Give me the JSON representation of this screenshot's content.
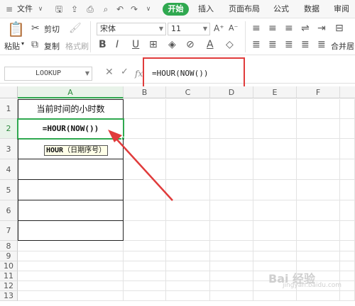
{
  "menubar": {
    "file": "文件",
    "tabs": [
      "开始",
      "插入",
      "页面布局",
      "公式",
      "数据",
      "审阅"
    ]
  },
  "ribbon": {
    "paste": "粘贴",
    "cut": "剪切",
    "copy": "复制",
    "format_painter": "格式刷",
    "font_name": "宋体",
    "font_size": "11",
    "merge_center": "合并居中"
  },
  "formula_bar": {
    "name_box": "LOOKUP",
    "fx": "fx",
    "formula": "=HOUR(NOW())"
  },
  "grid": {
    "columns": [
      "A",
      "B",
      "C",
      "D",
      "E",
      "F"
    ],
    "rows": [
      "1",
      "2",
      "3",
      "4",
      "5",
      "6",
      "7",
      "8",
      "9",
      "10",
      "11",
      "12",
      "13"
    ],
    "cells": {
      "A1": "当前时间的小时数",
      "A2": "=HOUR(NOW())"
    },
    "tooltip_func": "HOUR",
    "tooltip_arg": "（日期序号）"
  },
  "watermark": {
    "line1": "Bai 经验",
    "line2": "jingyan.baidu.com"
  },
  "colors": {
    "accent": "#2fa84f",
    "annotation": "#e03b3b"
  }
}
